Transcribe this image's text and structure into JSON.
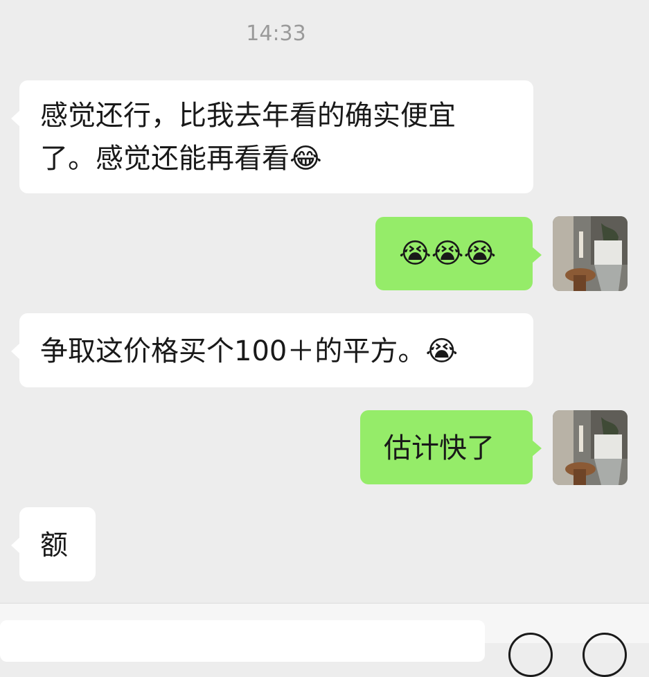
{
  "chat": {
    "timestamp": "14:33",
    "messages": [
      {
        "sender": "other",
        "lines": [
          "感觉还行，比我去年看的确实便宜",
          "了。感觉还能再看看😂"
        ]
      },
      {
        "sender": "me",
        "text": "😭😭😭"
      },
      {
        "sender": "other",
        "text": "争取这价格买个100＋的平方。😭"
      },
      {
        "sender": "me",
        "text": "估计快了"
      },
      {
        "sender": "other",
        "text": "额"
      }
    ]
  },
  "input_bar": {
    "icons": [
      "voice-icon",
      "emoji-icon"
    ]
  },
  "colors": {
    "background": "#ededed",
    "incoming_bubble": "#ffffff",
    "outgoing_bubble": "#95ec69",
    "timestamp_text": "#9a9a9a"
  }
}
